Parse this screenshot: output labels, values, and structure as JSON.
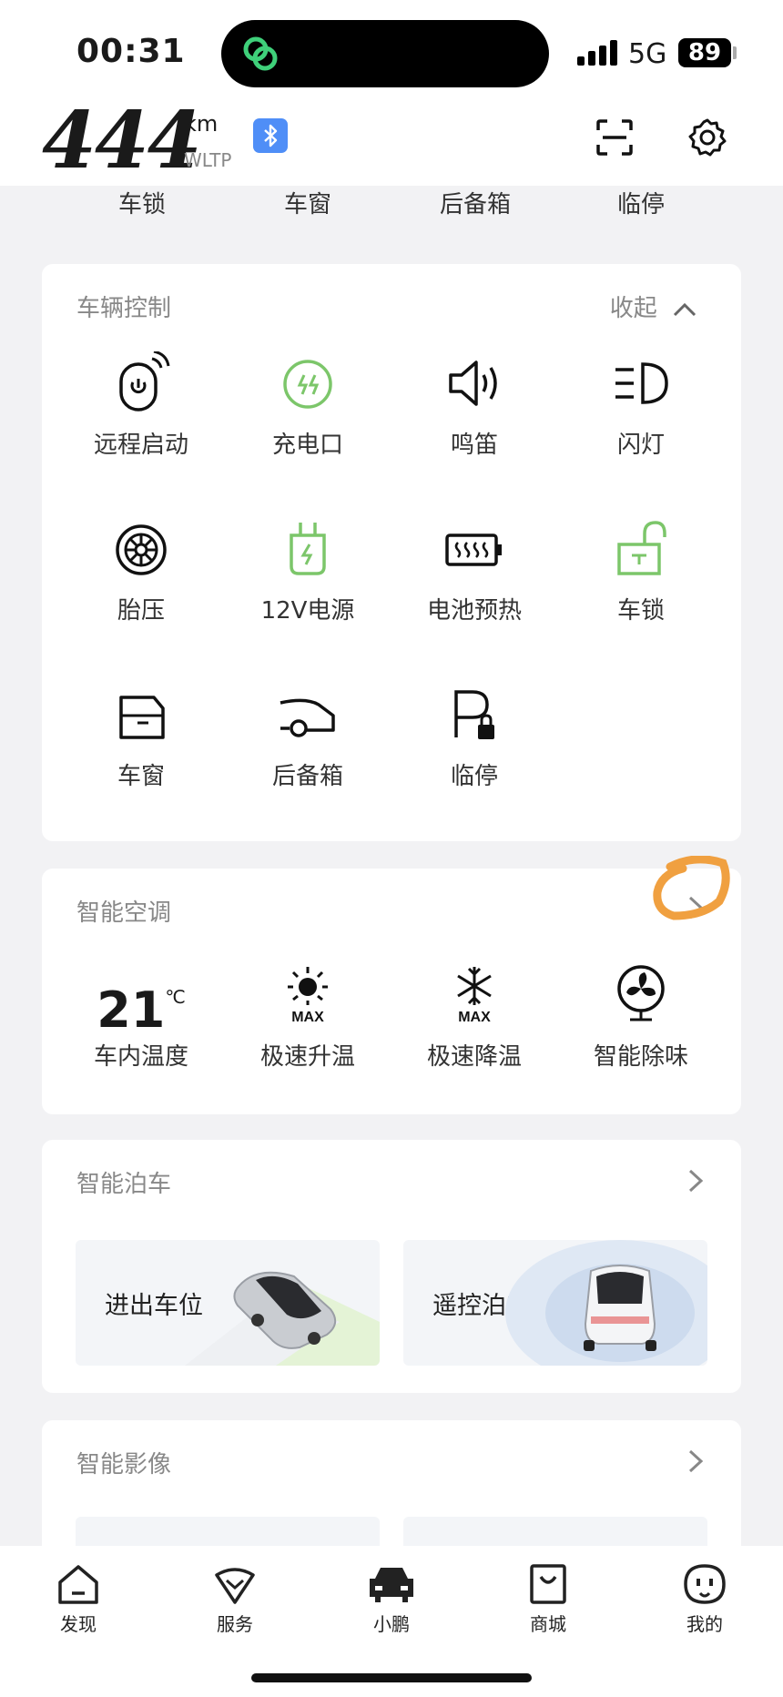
{
  "status_bar": {
    "time": "00:31",
    "network": "5G",
    "battery": "89"
  },
  "header": {
    "range_value": "444",
    "range_unit": "km",
    "range_standard": "WLTP"
  },
  "quick_row": [
    "车锁",
    "车窗",
    "后备箱",
    "临停"
  ],
  "vehicle_control": {
    "title": "车辆控制",
    "collapse_label": "收起",
    "items": [
      {
        "label": "远程启动",
        "icon": "remote-start-icon"
      },
      {
        "label": "充电口",
        "icon": "charge-port-icon"
      },
      {
        "label": "鸣笛",
        "icon": "horn-icon"
      },
      {
        "label": "闪灯",
        "icon": "flash-lights-icon"
      },
      {
        "label": "胎压",
        "icon": "tire-pressure-icon"
      },
      {
        "label": "12V电源",
        "icon": "power-12v-icon"
      },
      {
        "label": "电池预热",
        "icon": "battery-preheat-icon"
      },
      {
        "label": "车锁",
        "icon": "unlock-icon"
      },
      {
        "label": "车窗",
        "icon": "window-icon"
      },
      {
        "label": "后备箱",
        "icon": "trunk-icon"
      },
      {
        "label": "临停",
        "icon": "temp-parking-icon"
      }
    ]
  },
  "climate": {
    "title": "智能空调",
    "temp_value": "21",
    "temp_unit": "℃",
    "items": [
      {
        "label": "车内温度"
      },
      {
        "label": "极速升温",
        "icon": "max-heat-icon"
      },
      {
        "label": "极速降温",
        "icon": "max-cool-icon"
      },
      {
        "label": "智能除味",
        "icon": "fan-icon"
      }
    ]
  },
  "parking": {
    "title": "智能泊车",
    "tiles": [
      "进出车位",
      "遥控泊车"
    ]
  },
  "camera": {
    "title": "智能影像"
  },
  "tabbar": [
    "发现",
    "服务",
    "小鹏",
    "商城",
    "我的"
  ],
  "colors": {
    "accent_green": "#7cc66a",
    "annotation_orange": "#f0a040"
  }
}
